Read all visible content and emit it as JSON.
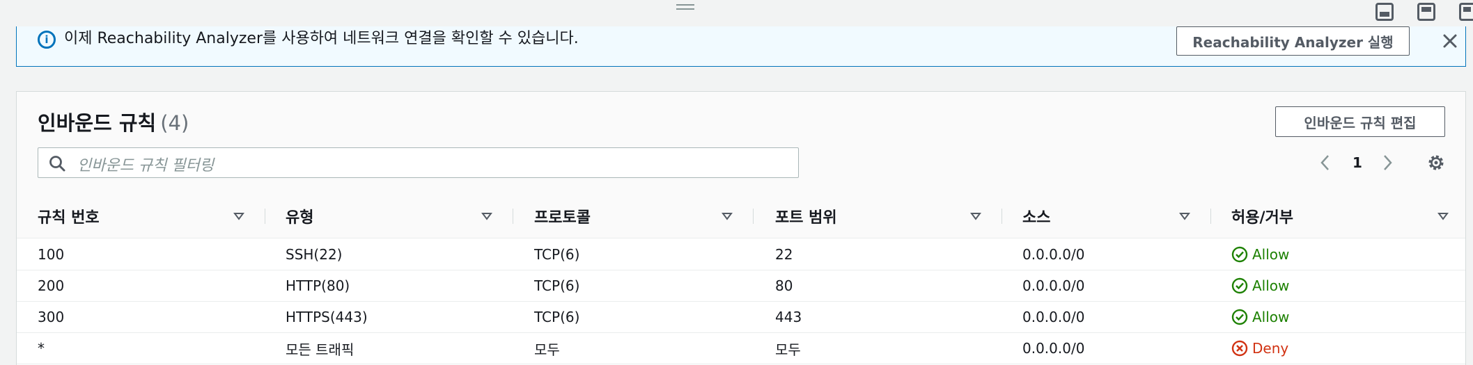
{
  "banner": {
    "message": "이제 Reachability Analyzer를 사용하여 네트워크 연결을 확인할 수 있습니다.",
    "run_button": "Reachability Analyzer 실행"
  },
  "inbound": {
    "title": "인바운드 규칙",
    "count": "(4)",
    "edit_button": "인바운드 규칙 편집",
    "search_placeholder": "인바운드 규칙 필터링",
    "page": "1",
    "columns": [
      "규칙 번호",
      "유형",
      "프로토콜",
      "포트 범위",
      "소스",
      "허용/거부"
    ],
    "rows": [
      {
        "rule": "100",
        "type": "SSH(22)",
        "protocol": "TCP(6)",
        "port": "22",
        "source": "0.0.0.0/0",
        "action": "Allow"
      },
      {
        "rule": "200",
        "type": "HTTP(80)",
        "protocol": "TCP(6)",
        "port": "80",
        "source": "0.0.0.0/0",
        "action": "Allow"
      },
      {
        "rule": "300",
        "type": "HTTPS(443)",
        "protocol": "TCP(6)",
        "port": "443",
        "source": "0.0.0.0/0",
        "action": "Allow"
      },
      {
        "rule": "*",
        "type": "모든 트래픽",
        "protocol": "모두",
        "port": "모두",
        "source": "0.0.0.0/0",
        "action": "Deny"
      }
    ]
  },
  "icons": {
    "info": "info-icon",
    "close": "close-icon",
    "search": "search-icon",
    "settings": "gear-icon",
    "allow": "check-circle-icon",
    "deny": "x-circle-icon"
  },
  "colors": {
    "accent": "#0073bb",
    "allow": "#1d8102",
    "deny": "#d13212",
    "banner_bg": "#f1faff"
  }
}
